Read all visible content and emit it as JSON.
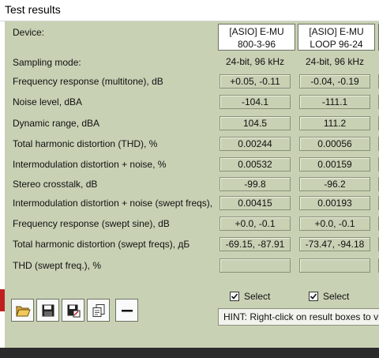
{
  "window": {
    "title": "Test results"
  },
  "device_label": "Device:",
  "devices": [
    {
      "line1": "[ASIO] E-MU",
      "line2": "800-3-96",
      "select_label": "Select",
      "selected": true
    },
    {
      "line1": "[ASIO] E-MU",
      "line2": "LOOP 96-24",
      "select_label": "Select",
      "selected": true
    }
  ],
  "sampling": {
    "label": "Sampling mode:",
    "values": [
      "24-bit, 96 kHz",
      "24-bit, 96 kHz"
    ]
  },
  "rows": [
    {
      "label": "Frequency response (multitone), dB",
      "values": [
        "+0.05, -0.11",
        "-0.04, -0.19"
      ]
    },
    {
      "label": "Noise level, dBA",
      "values": [
        "-104.1",
        "-111.1"
      ]
    },
    {
      "label": "Dynamic range, dBA",
      "values": [
        "104.5",
        "111.2"
      ]
    },
    {
      "label": "Total harmonic distortion (THD), %",
      "values": [
        "0.00244",
        "0.00056"
      ]
    },
    {
      "label": "Intermodulation distortion + noise, %",
      "values": [
        "0.00532",
        "0.00159"
      ]
    },
    {
      "label": "Stereo crosstalk, dB",
      "values": [
        "-99.8",
        "-96.2"
      ]
    },
    {
      "label": "Intermodulation distortion + noise (swept freqs),",
      "values": [
        "0.00415",
        "0.00193"
      ]
    },
    {
      "label": "Frequency response (swept sine), dB",
      "values": [
        "+0.0, -0.1",
        "+0.0, -0.1"
      ]
    },
    {
      "label": "Total harmonic distortion (swept freqs), дБ",
      "values": [
        "-69.15, -87.91",
        "-73.47, -94.18"
      ]
    },
    {
      "label": "THD (swept freq.), %",
      "values": [
        "",
        ""
      ]
    }
  ],
  "toolbar": {
    "buttons": [
      {
        "name": "open-button",
        "icon": "folder-open-icon"
      },
      {
        "name": "save-button",
        "icon": "floppy-disk-icon"
      },
      {
        "name": "save-as-button",
        "icon": "floppy-disk-edit-icon"
      },
      {
        "name": "copy-button",
        "icon": "copy-pages-icon"
      },
      {
        "name": "remove-button",
        "icon": "minus-icon"
      }
    ]
  },
  "hint": "HINT: Right-click on result boxes to view"
}
